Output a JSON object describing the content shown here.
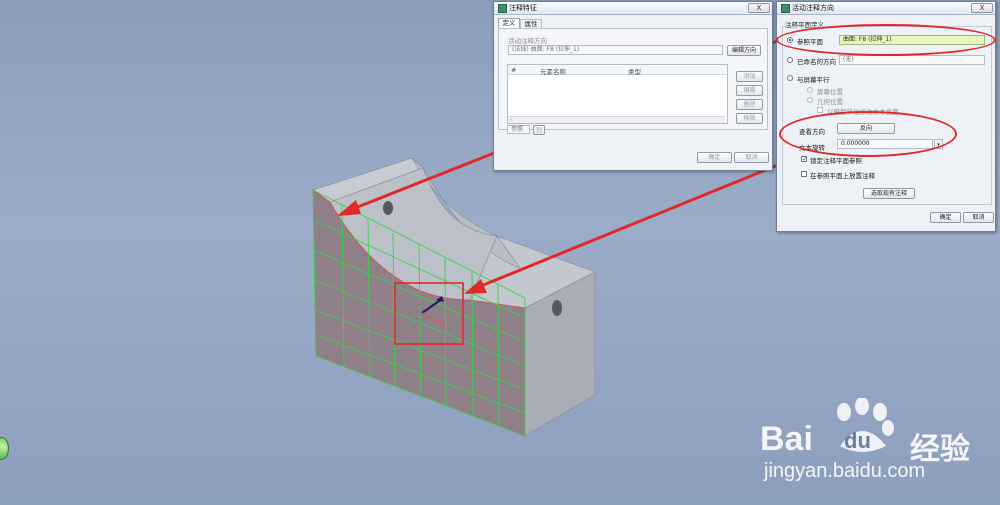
{
  "dialog_annotation": {
    "title": "注释特征",
    "close": "X",
    "tabs": [
      "定义",
      "属性"
    ],
    "direction_group": "活动注释方向",
    "direction_value": "(法线) 曲面: F8 (拉伸_1)",
    "edit_direction": "编辑方向",
    "columns": [
      "#",
      "元素名称",
      "类型"
    ],
    "side_buttons": [
      "添加",
      "编辑",
      "删除",
      "移除"
    ],
    "bottom_select": "参照",
    "bottom_btn": "列",
    "ok": "确定",
    "cancel": "取消"
  },
  "dialog_direction": {
    "title": "活动注释方向",
    "close": "X",
    "group": "注释平面定义",
    "ref_plane_label": "参照平面",
    "ref_plane_value": "曲面: F8 (拉伸_1)",
    "named_dir_label": "已命名的方向",
    "named_dir_value": "(无)",
    "screen_parallel_label": "与屏幕平行",
    "screen_pos_label": "屏幕位置",
    "geom_pos_label": "几何位置",
    "geom_sub_label": "以模型单位修改文本高度",
    "view_dir_label": "查看方向",
    "flip_label": "反向",
    "rotation_label": "文本旋转",
    "rotation_value": "0.000000",
    "lock_label": "锁定注释平面参照",
    "on_plane_label": "在参照平面上放置注释",
    "select_existing": "选取现有注释",
    "ok": "确定",
    "cancel": "取消"
  },
  "watermark": {
    "brand": "Bai",
    "brand2": "du",
    "brand_cn": "经验",
    "url": "jingyan.baidu.com"
  },
  "colors": {
    "highlight": "#e02a2a",
    "grid": "#39d24a",
    "face": "#8f7f88"
  }
}
